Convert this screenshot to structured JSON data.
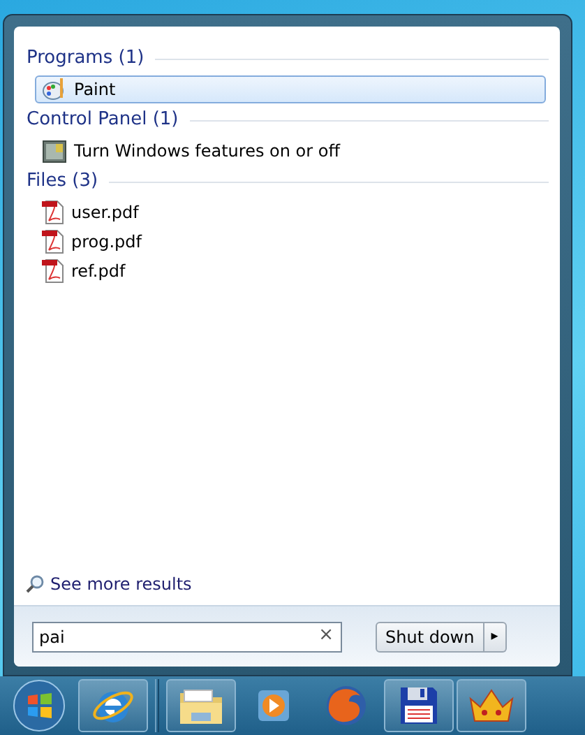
{
  "sections": [
    {
      "heading": "Programs (1)",
      "items": [
        {
          "kind": "paint",
          "label": "Paint",
          "selected": true
        }
      ]
    },
    {
      "heading": "Control Panel (1)",
      "items": [
        {
          "kind": "control-panel",
          "label": "Turn Windows features on or off",
          "selected": false
        }
      ]
    },
    {
      "heading": "Files (3)",
      "items": [
        {
          "kind": "pdf",
          "label": "user.pdf",
          "selected": false
        },
        {
          "kind": "pdf",
          "label": "prog.pdf",
          "selected": false
        },
        {
          "kind": "pdf",
          "label": "ref.pdf",
          "selected": false
        }
      ]
    }
  ],
  "see_more": "See more results",
  "search": {
    "value": "pai",
    "clear": "×"
  },
  "shutdown": {
    "label": "Shut down",
    "arrow": "▸"
  },
  "taskbar": [
    {
      "kind": "start",
      "running": false
    },
    {
      "kind": "browser-e",
      "running": true
    },
    {
      "kind": "folder",
      "running": true
    },
    {
      "kind": "media",
      "running": false
    },
    {
      "kind": "fox",
      "running": false
    },
    {
      "kind": "floppy",
      "running": true
    },
    {
      "kind": "crown",
      "running": true
    }
  ]
}
